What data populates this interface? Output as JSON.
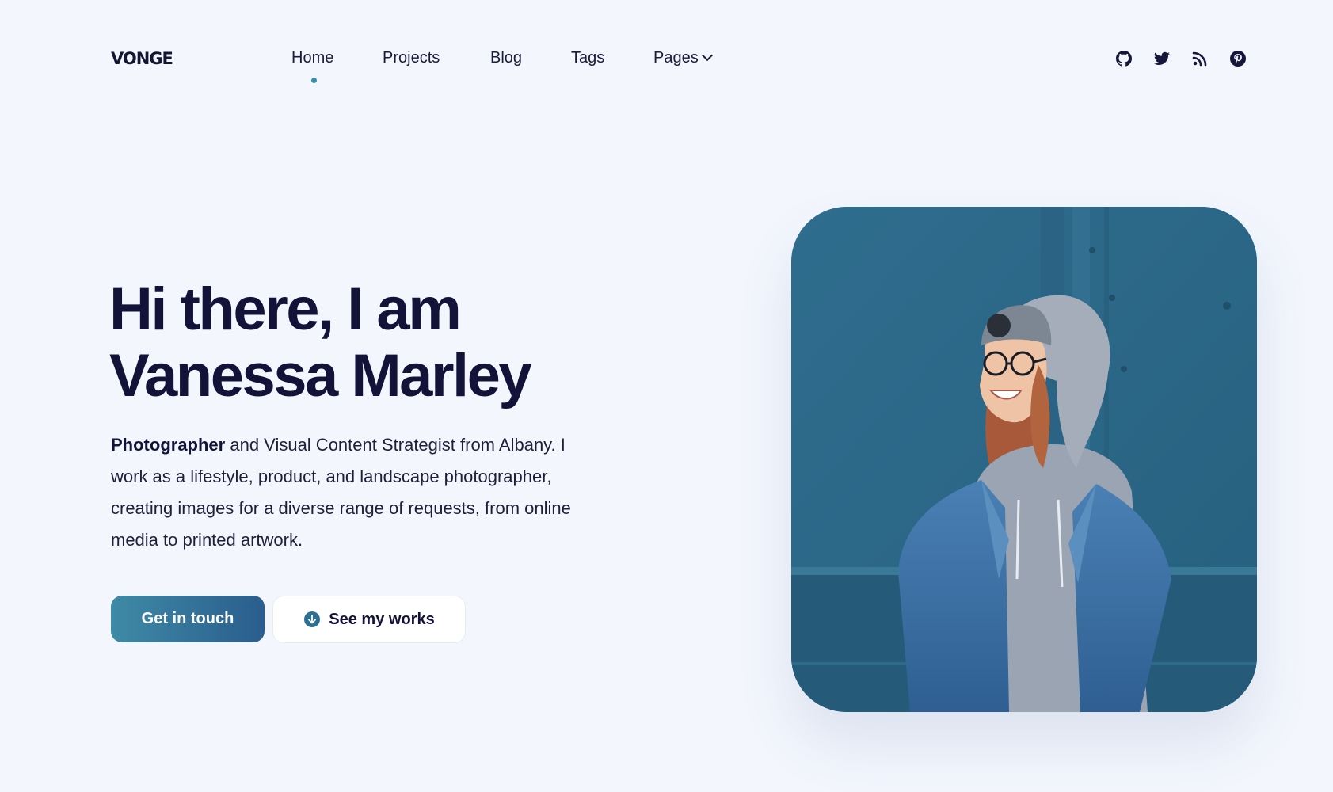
{
  "brand": {
    "logo": "VONGE",
    "accent": "#3b8fa8",
    "text": "#13133a",
    "background": "#f3f6fd"
  },
  "nav": {
    "items": [
      {
        "label": "Home",
        "active": true
      },
      {
        "label": "Projects",
        "active": false
      },
      {
        "label": "Blog",
        "active": false
      },
      {
        "label": "Tags",
        "active": false
      },
      {
        "label": "Pages",
        "active": false,
        "dropdown": true
      }
    ]
  },
  "social": [
    {
      "name": "github-icon"
    },
    {
      "name": "twitter-icon"
    },
    {
      "name": "rss-icon"
    },
    {
      "name": "pinterest-icon"
    }
  ],
  "hero": {
    "title_line1": "Hi there, I am",
    "title_line2": "Vanessa Marley",
    "intro_bold": "Photographer",
    "intro_rest": " and Visual Content Strategist from Albany. I work as a lifestyle, product, and landscape photographer, creating images for a diverse range of requests, from online media to printed artwork.",
    "primary_button": "Get in touch",
    "secondary_button": "See my works"
  },
  "photo": {
    "subject": "smiling woman in grey hoodie, beanie, glasses and denim jacket against blue wall"
  }
}
